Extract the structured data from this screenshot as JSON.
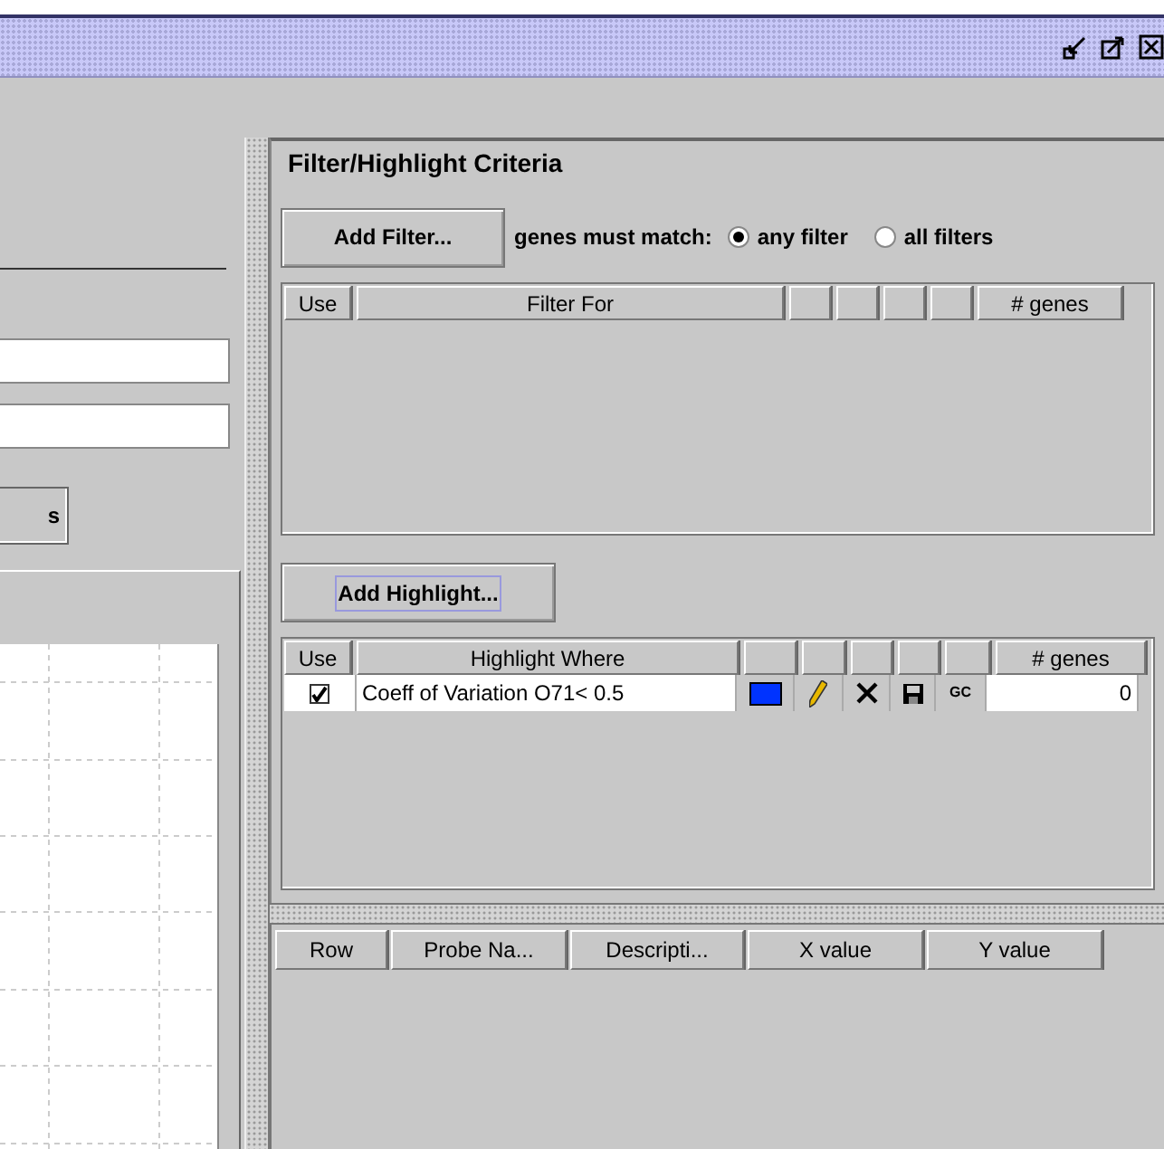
{
  "left_panel": {
    "button": "s"
  },
  "criteria": {
    "title": "Filter/Highlight Criteria",
    "add_filter": "Add Filter...",
    "match_label": "genes must match:",
    "match_options": [
      {
        "label": "any filter",
        "selected": true
      },
      {
        "label": "all filters",
        "selected": false
      }
    ],
    "filter_table": {
      "columns": [
        "Use",
        "Filter For"
      ],
      "count_column": "# genes"
    },
    "add_highlight": {
      "label": "Add Highlight...",
      "focused": true
    },
    "highlight_table": {
      "columns": [
        "Use",
        "Highlight Where"
      ],
      "count_column": "# genes",
      "rows": [
        {
          "checked": true,
          "condition": "Coeff of Variation O71< 0.5",
          "color": "#0033ff",
          "gc": "GC",
          "count": "0"
        }
      ]
    }
  },
  "results_table": {
    "columns": [
      "Row",
      "Probe Na...",
      "Descripti...",
      "X value",
      "Y value"
    ]
  }
}
